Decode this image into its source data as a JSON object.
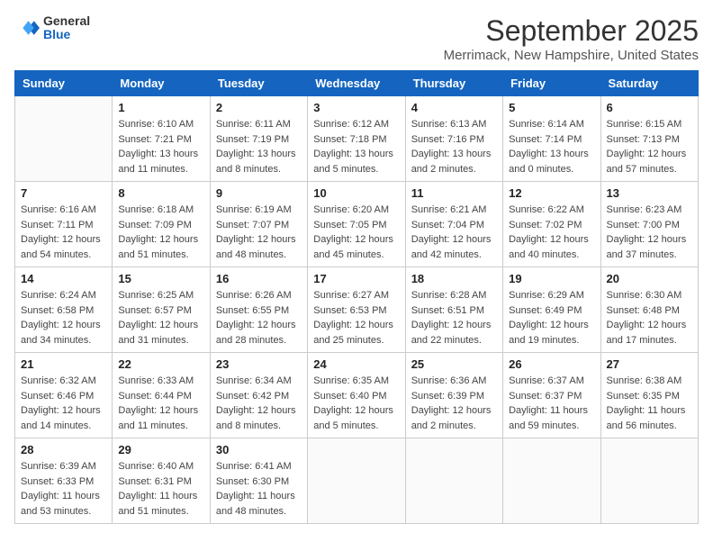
{
  "header": {
    "logo": {
      "general": "General",
      "blue": "Blue"
    },
    "title": "September 2025",
    "subtitle": "Merrimack, New Hampshire, United States"
  },
  "days_of_week": [
    "Sunday",
    "Monday",
    "Tuesday",
    "Wednesday",
    "Thursday",
    "Friday",
    "Saturday"
  ],
  "weeks": [
    [
      {
        "day": "",
        "sunrise": "",
        "sunset": "",
        "daylight": ""
      },
      {
        "day": "1",
        "sunrise": "Sunrise: 6:10 AM",
        "sunset": "Sunset: 7:21 PM",
        "daylight": "Daylight: 13 hours and 11 minutes."
      },
      {
        "day": "2",
        "sunrise": "Sunrise: 6:11 AM",
        "sunset": "Sunset: 7:19 PM",
        "daylight": "Daylight: 13 hours and 8 minutes."
      },
      {
        "day": "3",
        "sunrise": "Sunrise: 6:12 AM",
        "sunset": "Sunset: 7:18 PM",
        "daylight": "Daylight: 13 hours and 5 minutes."
      },
      {
        "day": "4",
        "sunrise": "Sunrise: 6:13 AM",
        "sunset": "Sunset: 7:16 PM",
        "daylight": "Daylight: 13 hours and 2 minutes."
      },
      {
        "day": "5",
        "sunrise": "Sunrise: 6:14 AM",
        "sunset": "Sunset: 7:14 PM",
        "daylight": "Daylight: 13 hours and 0 minutes."
      },
      {
        "day": "6",
        "sunrise": "Sunrise: 6:15 AM",
        "sunset": "Sunset: 7:13 PM",
        "daylight": "Daylight: 12 hours and 57 minutes."
      }
    ],
    [
      {
        "day": "7",
        "sunrise": "Sunrise: 6:16 AM",
        "sunset": "Sunset: 7:11 PM",
        "daylight": "Daylight: 12 hours and 54 minutes."
      },
      {
        "day": "8",
        "sunrise": "Sunrise: 6:18 AM",
        "sunset": "Sunset: 7:09 PM",
        "daylight": "Daylight: 12 hours and 51 minutes."
      },
      {
        "day": "9",
        "sunrise": "Sunrise: 6:19 AM",
        "sunset": "Sunset: 7:07 PM",
        "daylight": "Daylight: 12 hours and 48 minutes."
      },
      {
        "day": "10",
        "sunrise": "Sunrise: 6:20 AM",
        "sunset": "Sunset: 7:05 PM",
        "daylight": "Daylight: 12 hours and 45 minutes."
      },
      {
        "day": "11",
        "sunrise": "Sunrise: 6:21 AM",
        "sunset": "Sunset: 7:04 PM",
        "daylight": "Daylight: 12 hours and 42 minutes."
      },
      {
        "day": "12",
        "sunrise": "Sunrise: 6:22 AM",
        "sunset": "Sunset: 7:02 PM",
        "daylight": "Daylight: 12 hours and 40 minutes."
      },
      {
        "day": "13",
        "sunrise": "Sunrise: 6:23 AM",
        "sunset": "Sunset: 7:00 PM",
        "daylight": "Daylight: 12 hours and 37 minutes."
      }
    ],
    [
      {
        "day": "14",
        "sunrise": "Sunrise: 6:24 AM",
        "sunset": "Sunset: 6:58 PM",
        "daylight": "Daylight: 12 hours and 34 minutes."
      },
      {
        "day": "15",
        "sunrise": "Sunrise: 6:25 AM",
        "sunset": "Sunset: 6:57 PM",
        "daylight": "Daylight: 12 hours and 31 minutes."
      },
      {
        "day": "16",
        "sunrise": "Sunrise: 6:26 AM",
        "sunset": "Sunset: 6:55 PM",
        "daylight": "Daylight: 12 hours and 28 minutes."
      },
      {
        "day": "17",
        "sunrise": "Sunrise: 6:27 AM",
        "sunset": "Sunset: 6:53 PM",
        "daylight": "Daylight: 12 hours and 25 minutes."
      },
      {
        "day": "18",
        "sunrise": "Sunrise: 6:28 AM",
        "sunset": "Sunset: 6:51 PM",
        "daylight": "Daylight: 12 hours and 22 minutes."
      },
      {
        "day": "19",
        "sunrise": "Sunrise: 6:29 AM",
        "sunset": "Sunset: 6:49 PM",
        "daylight": "Daylight: 12 hours and 19 minutes."
      },
      {
        "day": "20",
        "sunrise": "Sunrise: 6:30 AM",
        "sunset": "Sunset: 6:48 PM",
        "daylight": "Daylight: 12 hours and 17 minutes."
      }
    ],
    [
      {
        "day": "21",
        "sunrise": "Sunrise: 6:32 AM",
        "sunset": "Sunset: 6:46 PM",
        "daylight": "Daylight: 12 hours and 14 minutes."
      },
      {
        "day": "22",
        "sunrise": "Sunrise: 6:33 AM",
        "sunset": "Sunset: 6:44 PM",
        "daylight": "Daylight: 12 hours and 11 minutes."
      },
      {
        "day": "23",
        "sunrise": "Sunrise: 6:34 AM",
        "sunset": "Sunset: 6:42 PM",
        "daylight": "Daylight: 12 hours and 8 minutes."
      },
      {
        "day": "24",
        "sunrise": "Sunrise: 6:35 AM",
        "sunset": "Sunset: 6:40 PM",
        "daylight": "Daylight: 12 hours and 5 minutes."
      },
      {
        "day": "25",
        "sunrise": "Sunrise: 6:36 AM",
        "sunset": "Sunset: 6:39 PM",
        "daylight": "Daylight: 12 hours and 2 minutes."
      },
      {
        "day": "26",
        "sunrise": "Sunrise: 6:37 AM",
        "sunset": "Sunset: 6:37 PM",
        "daylight": "Daylight: 11 hours and 59 minutes."
      },
      {
        "day": "27",
        "sunrise": "Sunrise: 6:38 AM",
        "sunset": "Sunset: 6:35 PM",
        "daylight": "Daylight: 11 hours and 56 minutes."
      }
    ],
    [
      {
        "day": "28",
        "sunrise": "Sunrise: 6:39 AM",
        "sunset": "Sunset: 6:33 PM",
        "daylight": "Daylight: 11 hours and 53 minutes."
      },
      {
        "day": "29",
        "sunrise": "Sunrise: 6:40 AM",
        "sunset": "Sunset: 6:31 PM",
        "daylight": "Daylight: 11 hours and 51 minutes."
      },
      {
        "day": "30",
        "sunrise": "Sunrise: 6:41 AM",
        "sunset": "Sunset: 6:30 PM",
        "daylight": "Daylight: 11 hours and 48 minutes."
      },
      {
        "day": "",
        "sunrise": "",
        "sunset": "",
        "daylight": ""
      },
      {
        "day": "",
        "sunrise": "",
        "sunset": "",
        "daylight": ""
      },
      {
        "day": "",
        "sunrise": "",
        "sunset": "",
        "daylight": ""
      },
      {
        "day": "",
        "sunrise": "",
        "sunset": "",
        "daylight": ""
      }
    ]
  ]
}
